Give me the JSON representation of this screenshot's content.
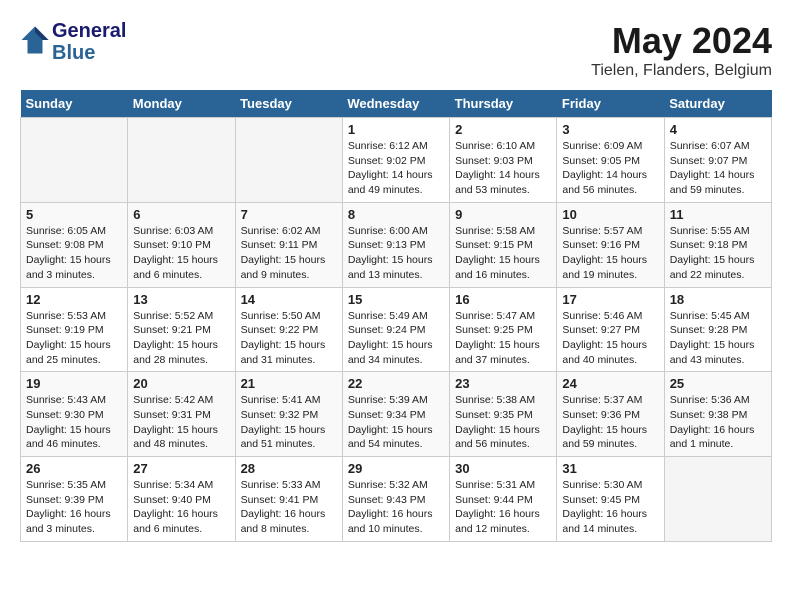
{
  "header": {
    "logo_line1": "General",
    "logo_line2": "Blue",
    "month_year": "May 2024",
    "location": "Tielen, Flanders, Belgium"
  },
  "weekdays": [
    "Sunday",
    "Monday",
    "Tuesday",
    "Wednesday",
    "Thursday",
    "Friday",
    "Saturday"
  ],
  "weeks": [
    [
      {
        "day": "",
        "info": ""
      },
      {
        "day": "",
        "info": ""
      },
      {
        "day": "",
        "info": ""
      },
      {
        "day": "1",
        "info": "Sunrise: 6:12 AM\nSunset: 9:02 PM\nDaylight: 14 hours\nand 49 minutes."
      },
      {
        "day": "2",
        "info": "Sunrise: 6:10 AM\nSunset: 9:03 PM\nDaylight: 14 hours\nand 53 minutes."
      },
      {
        "day": "3",
        "info": "Sunrise: 6:09 AM\nSunset: 9:05 PM\nDaylight: 14 hours\nand 56 minutes."
      },
      {
        "day": "4",
        "info": "Sunrise: 6:07 AM\nSunset: 9:07 PM\nDaylight: 14 hours\nand 59 minutes."
      }
    ],
    [
      {
        "day": "5",
        "info": "Sunrise: 6:05 AM\nSunset: 9:08 PM\nDaylight: 15 hours\nand 3 minutes."
      },
      {
        "day": "6",
        "info": "Sunrise: 6:03 AM\nSunset: 9:10 PM\nDaylight: 15 hours\nand 6 minutes."
      },
      {
        "day": "7",
        "info": "Sunrise: 6:02 AM\nSunset: 9:11 PM\nDaylight: 15 hours\nand 9 minutes."
      },
      {
        "day": "8",
        "info": "Sunrise: 6:00 AM\nSunset: 9:13 PM\nDaylight: 15 hours\nand 13 minutes."
      },
      {
        "day": "9",
        "info": "Sunrise: 5:58 AM\nSunset: 9:15 PM\nDaylight: 15 hours\nand 16 minutes."
      },
      {
        "day": "10",
        "info": "Sunrise: 5:57 AM\nSunset: 9:16 PM\nDaylight: 15 hours\nand 19 minutes."
      },
      {
        "day": "11",
        "info": "Sunrise: 5:55 AM\nSunset: 9:18 PM\nDaylight: 15 hours\nand 22 minutes."
      }
    ],
    [
      {
        "day": "12",
        "info": "Sunrise: 5:53 AM\nSunset: 9:19 PM\nDaylight: 15 hours\nand 25 minutes."
      },
      {
        "day": "13",
        "info": "Sunrise: 5:52 AM\nSunset: 9:21 PM\nDaylight: 15 hours\nand 28 minutes."
      },
      {
        "day": "14",
        "info": "Sunrise: 5:50 AM\nSunset: 9:22 PM\nDaylight: 15 hours\nand 31 minutes."
      },
      {
        "day": "15",
        "info": "Sunrise: 5:49 AM\nSunset: 9:24 PM\nDaylight: 15 hours\nand 34 minutes."
      },
      {
        "day": "16",
        "info": "Sunrise: 5:47 AM\nSunset: 9:25 PM\nDaylight: 15 hours\nand 37 minutes."
      },
      {
        "day": "17",
        "info": "Sunrise: 5:46 AM\nSunset: 9:27 PM\nDaylight: 15 hours\nand 40 minutes."
      },
      {
        "day": "18",
        "info": "Sunrise: 5:45 AM\nSunset: 9:28 PM\nDaylight: 15 hours\nand 43 minutes."
      }
    ],
    [
      {
        "day": "19",
        "info": "Sunrise: 5:43 AM\nSunset: 9:30 PM\nDaylight: 15 hours\nand 46 minutes."
      },
      {
        "day": "20",
        "info": "Sunrise: 5:42 AM\nSunset: 9:31 PM\nDaylight: 15 hours\nand 48 minutes."
      },
      {
        "day": "21",
        "info": "Sunrise: 5:41 AM\nSunset: 9:32 PM\nDaylight: 15 hours\nand 51 minutes."
      },
      {
        "day": "22",
        "info": "Sunrise: 5:39 AM\nSunset: 9:34 PM\nDaylight: 15 hours\nand 54 minutes."
      },
      {
        "day": "23",
        "info": "Sunrise: 5:38 AM\nSunset: 9:35 PM\nDaylight: 15 hours\nand 56 minutes."
      },
      {
        "day": "24",
        "info": "Sunrise: 5:37 AM\nSunset: 9:36 PM\nDaylight: 15 hours\nand 59 minutes."
      },
      {
        "day": "25",
        "info": "Sunrise: 5:36 AM\nSunset: 9:38 PM\nDaylight: 16 hours\nand 1 minute."
      }
    ],
    [
      {
        "day": "26",
        "info": "Sunrise: 5:35 AM\nSunset: 9:39 PM\nDaylight: 16 hours\nand 3 minutes."
      },
      {
        "day": "27",
        "info": "Sunrise: 5:34 AM\nSunset: 9:40 PM\nDaylight: 16 hours\nand 6 minutes."
      },
      {
        "day": "28",
        "info": "Sunrise: 5:33 AM\nSunset: 9:41 PM\nDaylight: 16 hours\nand 8 minutes."
      },
      {
        "day": "29",
        "info": "Sunrise: 5:32 AM\nSunset: 9:43 PM\nDaylight: 16 hours\nand 10 minutes."
      },
      {
        "day": "30",
        "info": "Sunrise: 5:31 AM\nSunset: 9:44 PM\nDaylight: 16 hours\nand 12 minutes."
      },
      {
        "day": "31",
        "info": "Sunrise: 5:30 AM\nSunset: 9:45 PM\nDaylight: 16 hours\nand 14 minutes."
      },
      {
        "day": "",
        "info": ""
      }
    ]
  ]
}
